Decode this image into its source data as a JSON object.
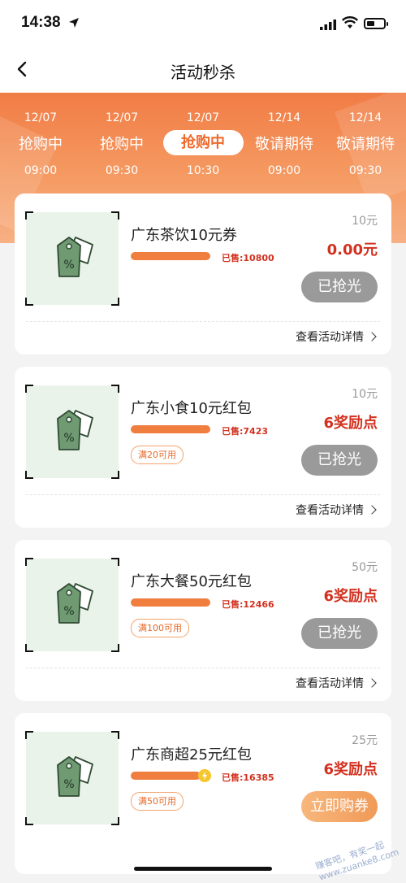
{
  "status": {
    "time": "14:38"
  },
  "header": {
    "title": "活动秒杀"
  },
  "tabs": [
    {
      "date": "12/07",
      "state": "抢购中",
      "time": "09:00",
      "active": false
    },
    {
      "date": "12/07",
      "state": "抢购中",
      "time": "09:30",
      "active": false
    },
    {
      "date": "12/07",
      "state": "抢购中",
      "time": "10:30",
      "active": true
    },
    {
      "date": "12/14",
      "state": "敬请期待",
      "time": "09:00",
      "active": false
    },
    {
      "date": "12/14",
      "state": "敬请期待",
      "time": "09:30",
      "active": false
    }
  ],
  "cards": [
    {
      "name": "广东茶饮10元券",
      "sold": "已售:10800",
      "tag": "",
      "orig": "10元",
      "price": "0.00元",
      "button": "已抢光",
      "detail": "查看活动详情",
      "progress": 1.0
    },
    {
      "name": "广东小食10元红包",
      "sold": "已售:7423",
      "tag": "满20可用",
      "orig": "10元",
      "price": "6奖励点",
      "button": "已抢光",
      "detail": "查看活动详情",
      "progress": 1.0
    },
    {
      "name": "广东大餐50元红包",
      "sold": "已售:12466",
      "tag": "满100可用",
      "orig": "50元",
      "price": "6奖励点",
      "button": "已抢光",
      "detail": "查看活动详情",
      "progress": 1.0
    },
    {
      "name": "广东商超25元红包",
      "sold": "已售:16385",
      "tag": "满50可用",
      "orig": "25元",
      "price": "6奖励点",
      "button": "立即购券",
      "detail": "",
      "progress": 0.95
    }
  ],
  "watermark": "赚客吧，有奖一起 www.zuanke8.com",
  "colors": {
    "accent": "#ef7e3f",
    "price": "#d2311f",
    "soldOut": "#9a9a9a"
  }
}
